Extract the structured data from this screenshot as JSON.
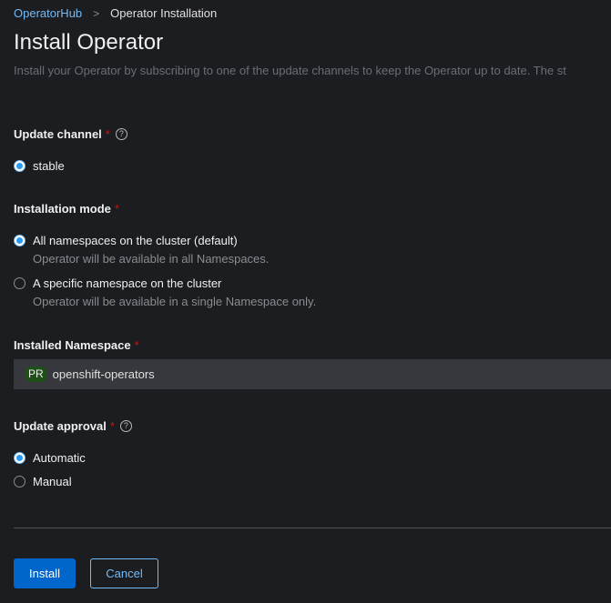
{
  "breadcrumb": {
    "parent": "OperatorHub",
    "separator": ">",
    "current": "Operator Installation"
  },
  "page": {
    "title": "Install Operator",
    "description": "Install your Operator by subscribing to one of the update channels to keep the Operator up to date. The st"
  },
  "update_channel": {
    "label": "Update channel",
    "required_mark": "*",
    "help_icon": "?",
    "options": [
      {
        "label": "stable",
        "checked": true
      }
    ]
  },
  "installation_mode": {
    "label": "Installation mode",
    "required_mark": "*",
    "options": [
      {
        "label": "All namespaces on the cluster (default)",
        "description": "Operator will be available in all Namespaces.",
        "checked": true
      },
      {
        "label": "A specific namespace on the cluster",
        "description": "Operator will be available in a single Namespace only.",
        "checked": false
      }
    ]
  },
  "installed_namespace": {
    "label": "Installed Namespace",
    "required_mark": "*",
    "badge": "PR",
    "value": "openshift-operators"
  },
  "update_approval": {
    "label": "Update approval",
    "required_mark": "*",
    "help_icon": "?",
    "options": [
      {
        "label": "Automatic",
        "checked": true
      },
      {
        "label": "Manual",
        "checked": false
      }
    ]
  },
  "actions": {
    "install_label": "Install",
    "cancel_label": "Cancel"
  },
  "colors": {
    "background": "#1b1d21",
    "link": "#73bcf7",
    "primary": "#0066cc",
    "required": "#c9190b",
    "namespace_badge": "#1e4f18"
  }
}
